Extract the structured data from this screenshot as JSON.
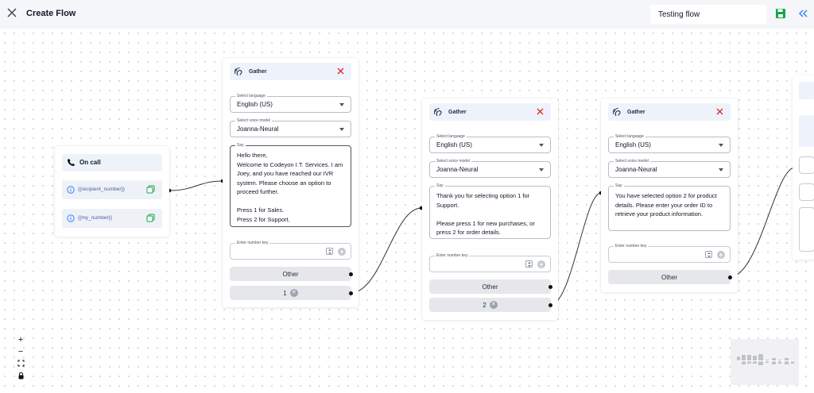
{
  "header": {
    "title": "Create Flow",
    "flow_name": "Testing flow"
  },
  "oncall": {
    "title": "On call",
    "variables": [
      "{{recipient_number}}",
      "{{my_number}}"
    ]
  },
  "gather_nodes": [
    {
      "title": "Gather",
      "language_label": "Select language",
      "language": "English (US)",
      "voice_label": "Select voice model",
      "voice": "Joanna-Neural",
      "say_label": "Say",
      "say": "Hello there,\nWelcome to Codeyon I.T. Services. I am Joey, and you have reached our IVR system. Please choose an option to proceed further.\n\nPress 1 for Sales.\nPress 2 for Support.",
      "number_label": "Enter number key",
      "branches": [
        {
          "label": "Other"
        },
        {
          "label": "1"
        }
      ]
    },
    {
      "title": "Gather",
      "language_label": "Select language",
      "language": "English (US)",
      "voice_label": "Select voice model",
      "voice": "Joanna-Neural",
      "say_label": "Say",
      "say": "Thank you for selecting option 1 for Support.\n\nPlease press 1 for new purchases, or press 2 for order details.",
      "number_label": "Enter number key",
      "branches": [
        {
          "label": "Other"
        },
        {
          "label": "2"
        }
      ]
    },
    {
      "title": "Gather",
      "language_label": "Select language",
      "language": "English (US)",
      "voice_label": "Select voice model",
      "voice": "Joanna-Neural",
      "say_label": "Say",
      "say": "You have selected option 2 for product details. Please enter your order ID to retrieve your product information.",
      "number_label": "Enter number key",
      "branches": [
        {
          "label": "Other"
        }
      ]
    }
  ],
  "controls": {
    "zoom_in": "+",
    "zoom_out": "−"
  },
  "colors": {
    "accent": "#3b82f6",
    "save_green": "#16a34a",
    "close_red": "#dc2626"
  }
}
